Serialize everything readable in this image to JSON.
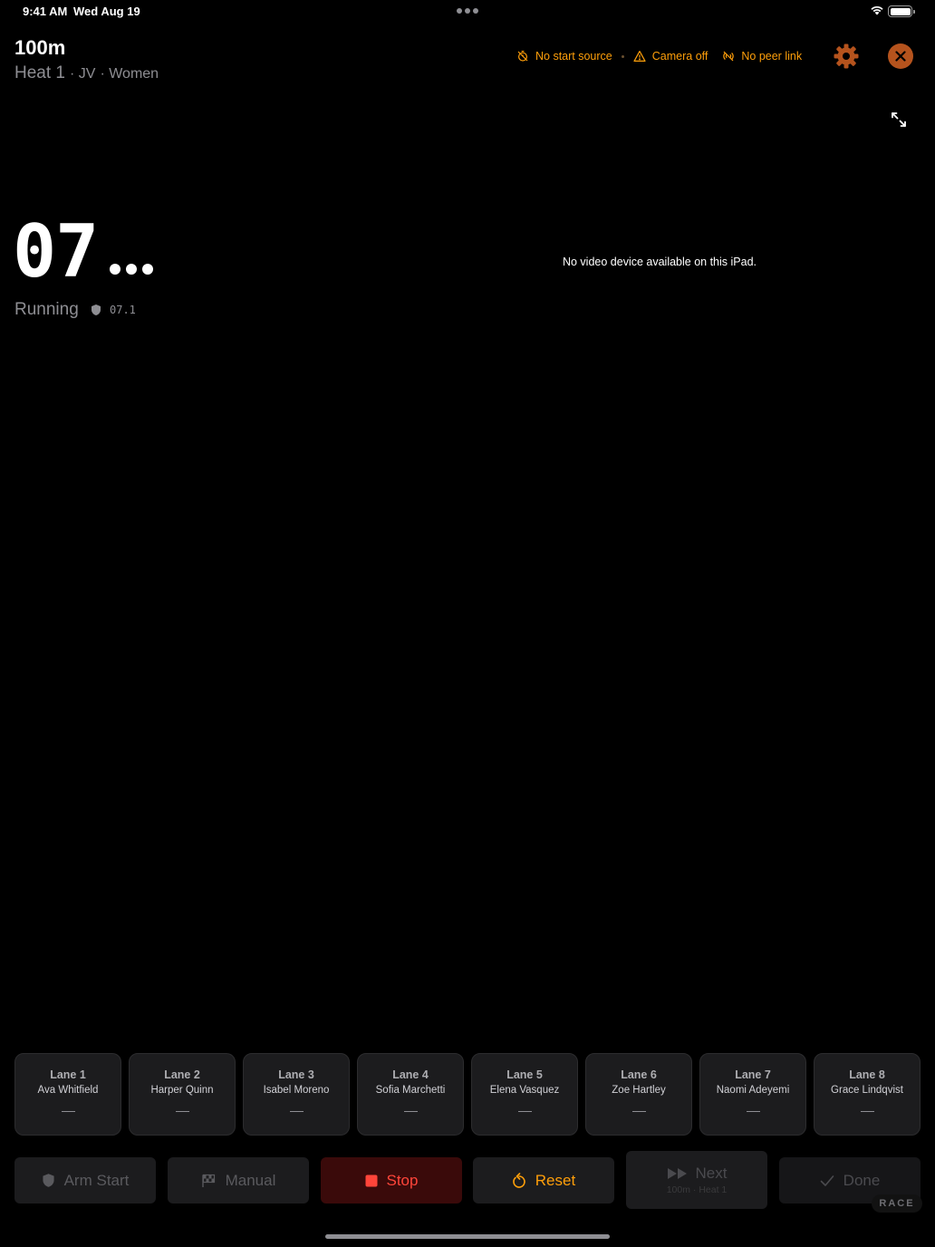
{
  "status_bar": {
    "time": "9:41 AM",
    "date": "Wed Aug 19"
  },
  "header": {
    "title": "100m",
    "heat": "Heat 1",
    "division": "· JV",
    "gender": "· Women",
    "chips": {
      "start_source": "No start source",
      "camera": "Camera off",
      "peer": "No peer link"
    }
  },
  "timer": {
    "display": "07",
    "state": "Running",
    "split": "07.1"
  },
  "video": {
    "message": "No video device available on this iPad."
  },
  "lanes": [
    {
      "title": "Lane 1",
      "name": "Ava Whitfield"
    },
    {
      "title": "Lane 2",
      "name": "Harper Quinn"
    },
    {
      "title": "Lane 3",
      "name": "Isabel Moreno"
    },
    {
      "title": "Lane 4",
      "name": "Sofia Marchetti"
    },
    {
      "title": "Lane 5",
      "name": "Elena Vasquez"
    },
    {
      "title": "Lane 6",
      "name": "Zoe Hartley"
    },
    {
      "title": "Lane 7",
      "name": "Naomi Adeyemi"
    },
    {
      "title": "Lane 8",
      "name": "Grace Lindqvist"
    }
  ],
  "actions": {
    "arm": "Arm Start",
    "manual": "Manual",
    "stop": "Stop",
    "reset": "Reset",
    "next": "Next",
    "next_sub": "100m · Heat 1",
    "done": "Done",
    "mode_tag": "RACE"
  },
  "colors": {
    "warning": "#ff9f0a",
    "stop": "#ff453a",
    "close_bg": "#b5531d"
  }
}
